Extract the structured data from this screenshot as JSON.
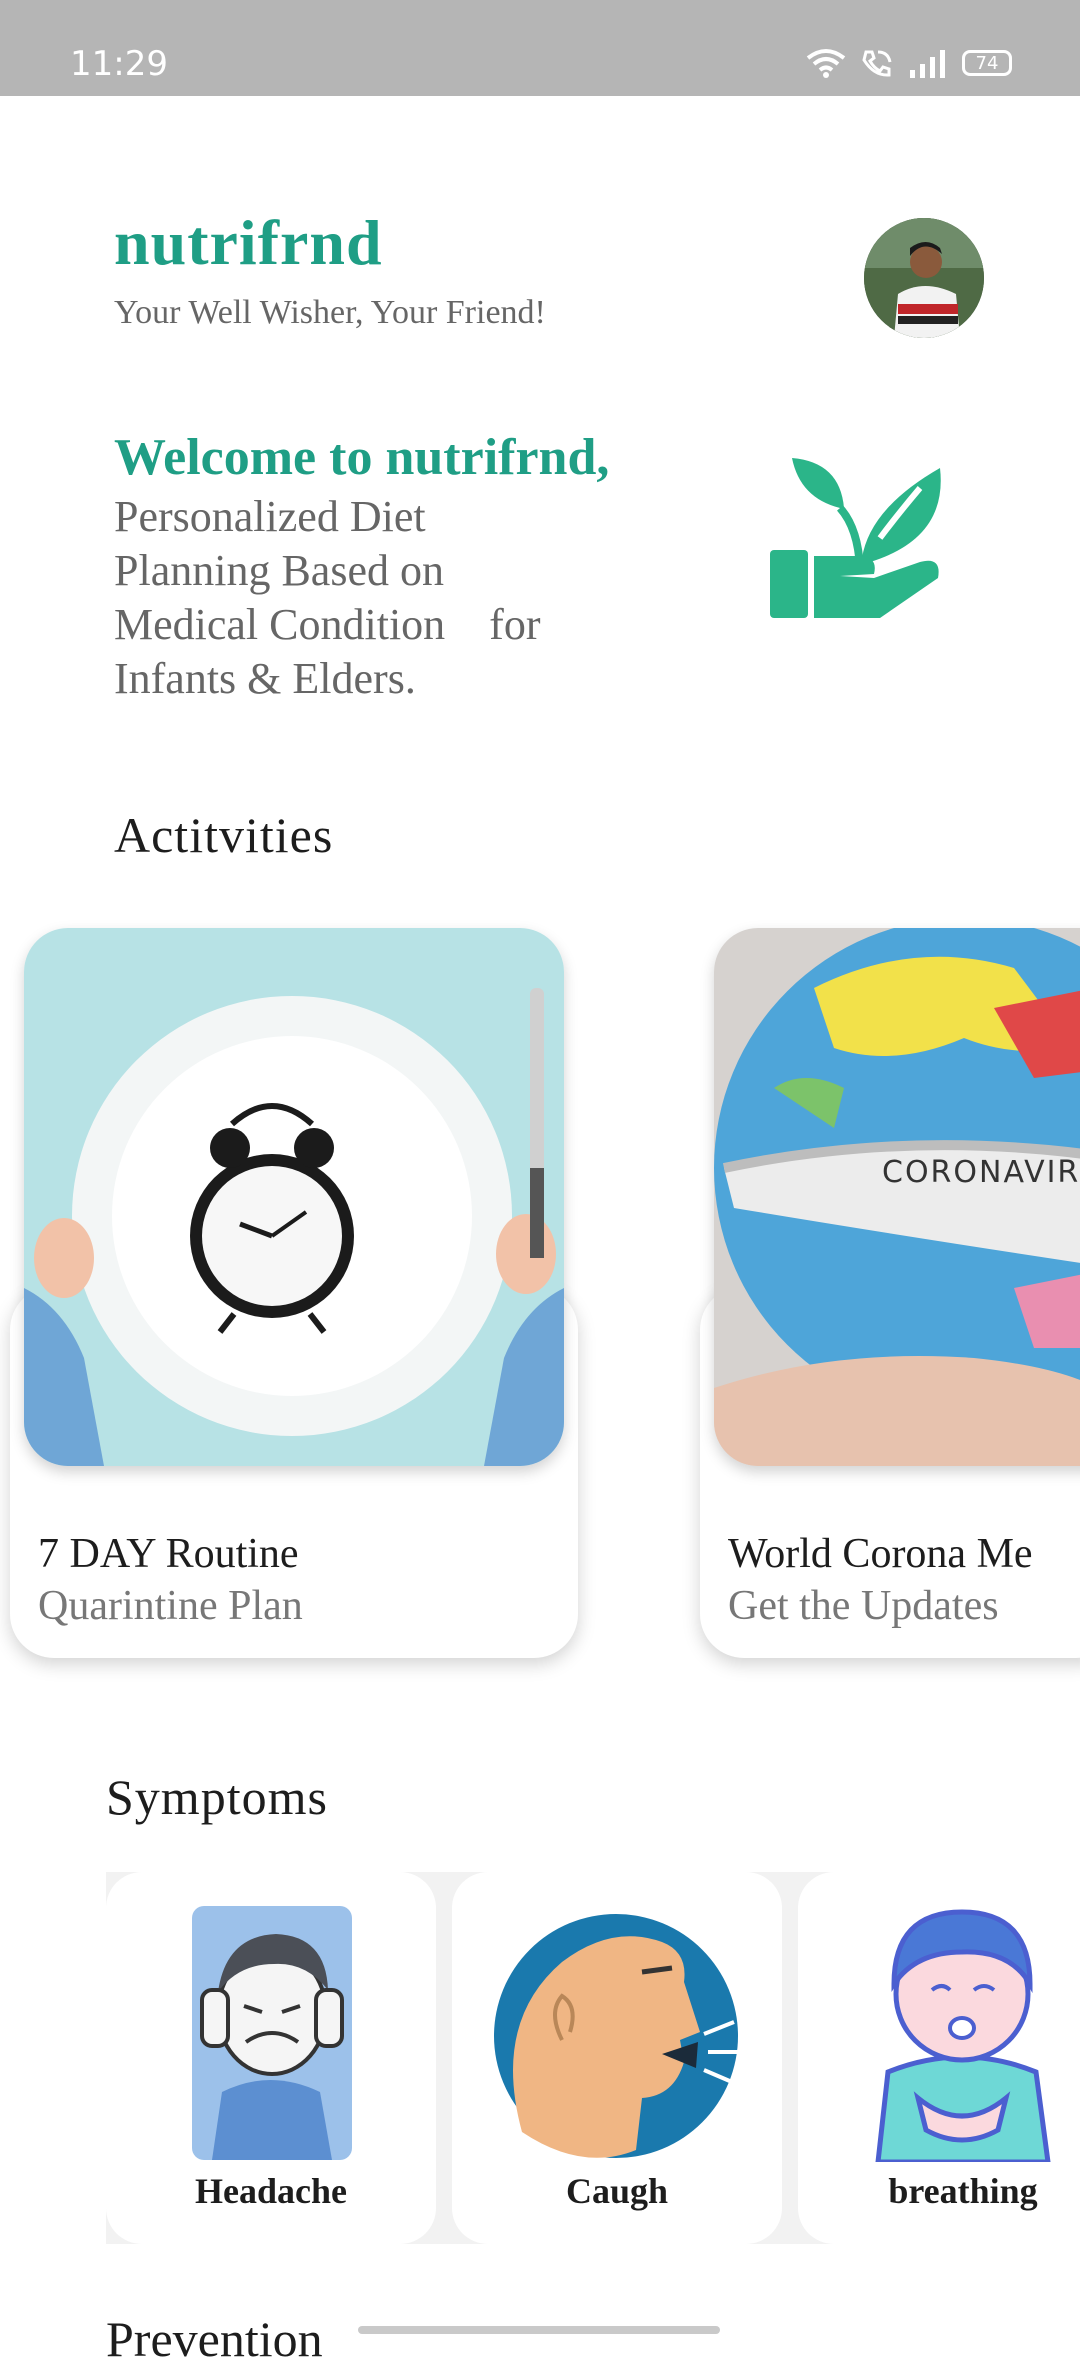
{
  "status_bar": {
    "time": "11:29",
    "battery": "74"
  },
  "header": {
    "app_name": "nutrifrnd",
    "tagline": "Your Well Wisher, Your Friend!"
  },
  "welcome": {
    "title": "Welcome to nutrifrnd,",
    "lines": [
      "Personalized Diet",
      "Planning Based on",
      "Medical Condition    for",
      "Infants & Elders."
    ]
  },
  "activities": {
    "heading": "Actitvities",
    "cards": [
      {
        "title": "7 DAY Routine",
        "subtitle": "Quarintine Plan"
      },
      {
        "title": "World Corona Me",
        "subtitle": "Get the Updates",
        "image_text": "CORONAVIRU"
      }
    ]
  },
  "symptoms": {
    "heading": "Symptoms",
    "items": [
      {
        "label": "Headache"
      },
      {
        "label": "Caugh"
      },
      {
        "label": "breathing"
      }
    ]
  },
  "next_section": {
    "heading": "Prevention"
  },
  "colors": {
    "brand": "#1f9e85",
    "icon_green": "#2bb589",
    "muted_text": "#666666"
  }
}
